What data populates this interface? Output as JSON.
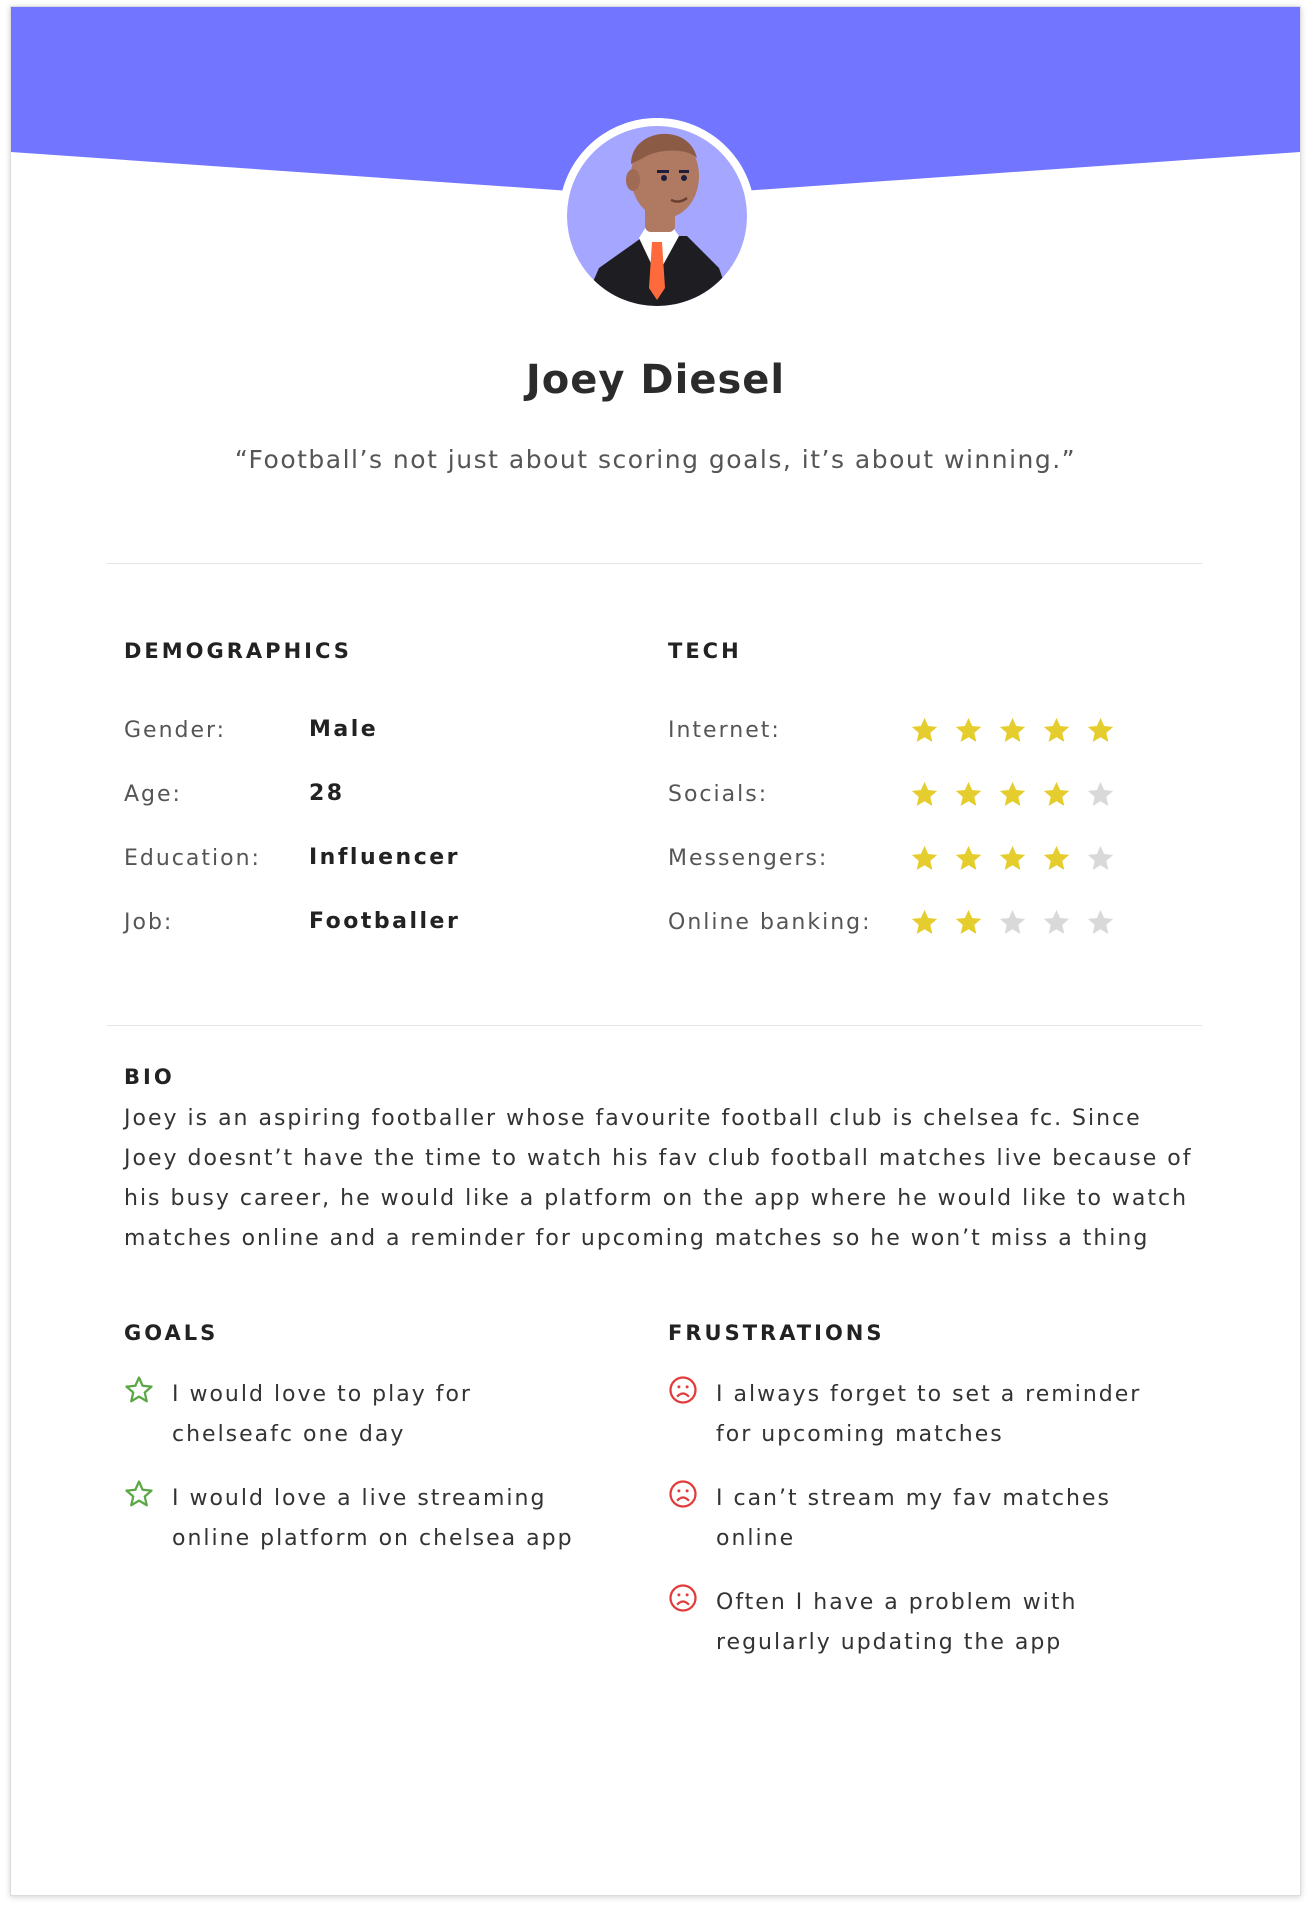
{
  "colors": {
    "banner": "#7275ff",
    "star_on": "#e6cd2e",
    "star_off": "#d9d9d9",
    "goal_icon": "#5ba745",
    "frustration_icon": "#e23b3b"
  },
  "profile": {
    "name": "Joey Diesel",
    "quote": "“Football’s not just about scoring goals, it’s about winning.”"
  },
  "demographics": {
    "heading": "DEMOGRAPHICS",
    "rows": [
      {
        "label": "Gender:",
        "value": "Male"
      },
      {
        "label": "Age:",
        "value": "28"
      },
      {
        "label": "Education:",
        "value": "Influencer"
      },
      {
        "label": "Job:",
        "value": "Footballer"
      }
    ]
  },
  "tech": {
    "heading": "TECH",
    "rows": [
      {
        "label": "Internet:",
        "rating": 5,
        "max": 5
      },
      {
        "label": "Socials:",
        "rating": 4,
        "max": 5
      },
      {
        "label": "Messengers:",
        "rating": 4,
        "max": 5
      },
      {
        "label": "Online banking:",
        "rating": 2,
        "max": 5
      }
    ]
  },
  "bio": {
    "heading": "BIO",
    "text": "Joey is an aspiring footballer whose favourite football club is chelsea fc. Since Joey doesnt’t have the time to watch his fav club football matches live because of his busy career, he would like a platform on the app where he would like to watch matches online and a reminder for upcoming matches so he won’t miss a thing"
  },
  "goals": {
    "heading": "GOALS",
    "icon": "star-outline-icon",
    "items": [
      "I would love to play for chelseafc one day",
      "I would love a live streaming online platform on chelsea app"
    ]
  },
  "frustrations": {
    "heading": "FRUSTRATIONS",
    "icon": "sad-face-icon",
    "items": [
      "I always forget to set a reminder for upcoming matches",
      "I can’t stream my fav matches online",
      "Often I have a problem with regularly updating the app"
    ]
  }
}
